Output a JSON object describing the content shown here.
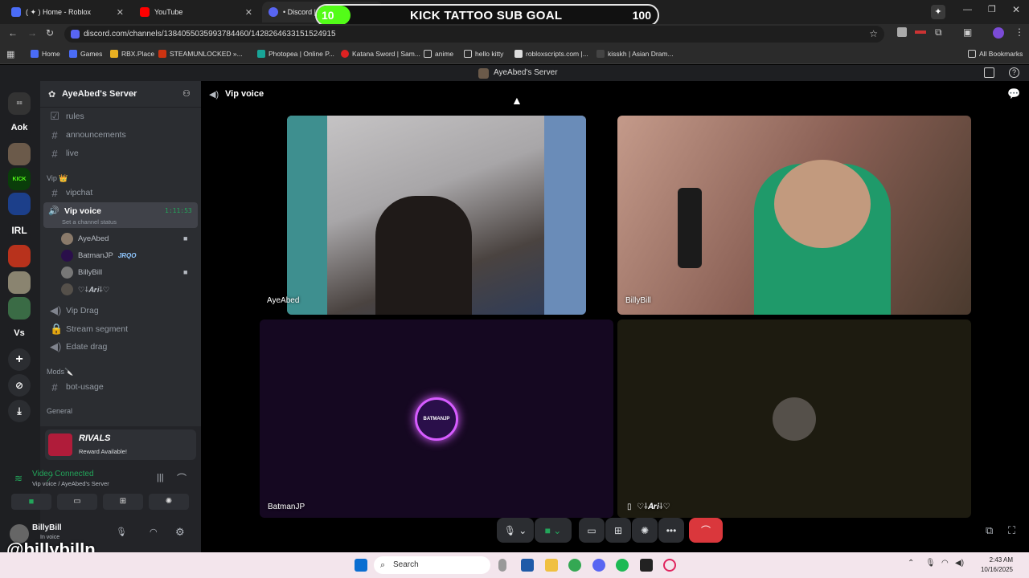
{
  "browser": {
    "tabs": [
      {
        "label": "( ✦ ) Home - Roblox",
        "color": "#4a6cf7"
      },
      {
        "label": "YouTube",
        "color": "#ff0000"
      },
      {
        "label": "• Discord |",
        "color": "#5865f2"
      }
    ],
    "url": "discord.com/channels/1384055035993784460/1428264633151524915",
    "bookmarks": [
      "Home",
      "Games",
      "RBX.Place",
      "STEAMUNLOCKED »...",
      "Photopea | Online P...",
      "Katana Sword | Sam...",
      "anime",
      "hello kitty",
      "robloxscripts.com |...",
      "kisskh | Asian Dram...",
      "All Bookmarks"
    ]
  },
  "goal": {
    "current": "10",
    "title": "KICK TATTOO SUB GOAL",
    "target": "100",
    "progress_fraction": 0.1
  },
  "discord": {
    "window_title": "AyeAbed's Server",
    "guild_labels": {
      "aok": "Aok",
      "irl": "IRL",
      "vs": "Vs"
    },
    "server_name": "AyeAbed's Server",
    "channels": [
      {
        "name": "rules",
        "icon": "rules-icon"
      },
      {
        "name": "announcements",
        "icon": "hash-icon"
      },
      {
        "name": "live",
        "icon": "hash-icon"
      }
    ],
    "vip_category": "Vip 👑",
    "vip_channels": {
      "vipchat": "vipchat",
      "voice": "Vip voice",
      "voice_timer": "1:11:53",
      "voice_status": "Set a channel status"
    },
    "voice_users": [
      {
        "name": "AyeAbed",
        "badge": ""
      },
      {
        "name": "BatmanJP",
        "badge": "JRQO"
      },
      {
        "name": "BillyBill",
        "badge": ""
      },
      {
        "name": "♡⸸𝑨𝒓𝒊⸸♡",
        "badge": ""
      }
    ],
    "more_channels": [
      "Vip Drag",
      "Stream segment",
      "Edate drag"
    ],
    "mods_category": "Mods🔪",
    "bot_channel": "bot-usage",
    "general_category": "General",
    "promo": {
      "title": "RIVALS",
      "subtitle": "Reward Available!"
    },
    "voice_status": {
      "title": "Video Connected",
      "subtitle": "Vip voice / AyeAbed's Server"
    },
    "user": {
      "name": "BillyBill",
      "status": "In voice"
    },
    "watermark": "@billybilln",
    "header_channel": "Vip voice",
    "tiles": [
      {
        "name": "AyeAbed"
      },
      {
        "name": "BillyBill"
      },
      {
        "name": "BatmanJP",
        "avatar_text": "BATMANJP"
      },
      {
        "name": "♡⸸𝑨𝒓𝒊⸸♡"
      }
    ]
  },
  "taskbar": {
    "search_placeholder": "Search",
    "time": "2:43 AM",
    "date": "10/16/2025"
  }
}
